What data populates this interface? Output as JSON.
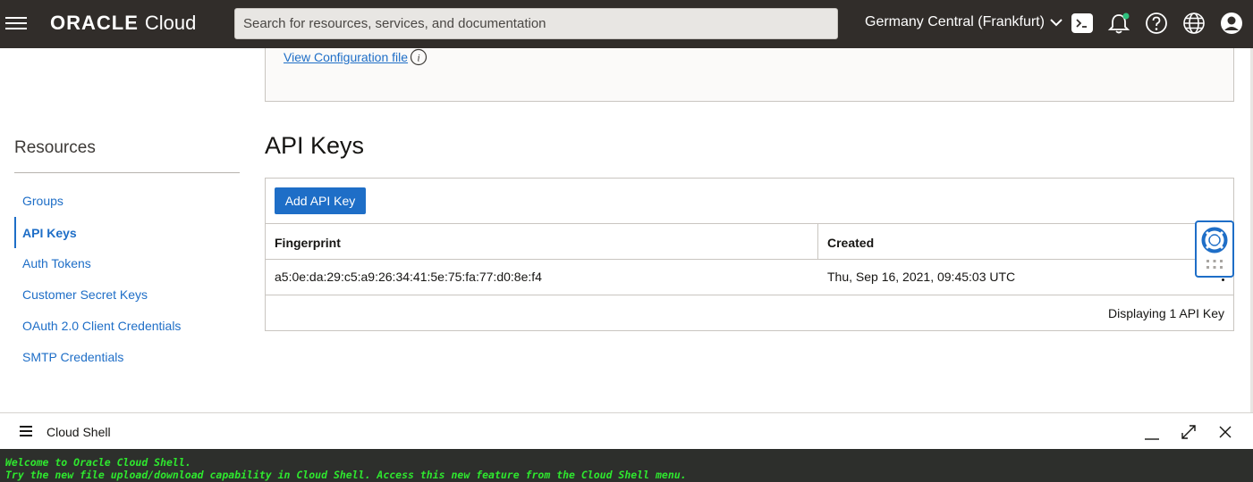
{
  "header": {
    "logo_primary": "ORACLE",
    "logo_secondary": "Cloud",
    "search_placeholder": "Search for resources, services, and documentation",
    "region": "Germany Central (Frankfurt)"
  },
  "config": {
    "link_label": "View Configuration file"
  },
  "resources": {
    "title": "Resources",
    "items": [
      {
        "label": "Groups",
        "active": false
      },
      {
        "label": "API Keys",
        "active": true
      },
      {
        "label": "Auth Tokens",
        "active": false
      },
      {
        "label": "Customer Secret Keys",
        "active": false
      },
      {
        "label": "OAuth 2.0 Client Credentials",
        "active": false
      },
      {
        "label": "SMTP Credentials",
        "active": false
      }
    ]
  },
  "api_keys": {
    "title": "API Keys",
    "add_button": "Add API Key",
    "columns": [
      "Fingerprint",
      "Created"
    ],
    "rows": [
      {
        "fingerprint": "a5:0e:da:29:c5:a9:26:34:41:5e:75:fa:77:d0:8e:f4",
        "created": "Thu, Sep 16, 2021, 09:45:03 UTC"
      }
    ],
    "footer": "Displaying 1 API Key"
  },
  "cloud_shell": {
    "title": "Cloud Shell",
    "lines": [
      "Welcome to Oracle Cloud Shell.",
      "Try the new file upload/download capability in Cloud Shell. Access this new feature from the Cloud Shell menu."
    ]
  },
  "colors": {
    "header_bg": "#312d2a",
    "link": "#1e6ec7",
    "terminal_bg": "#2d2f2c",
    "terminal_text": "#2ee82e",
    "notification_dot": "#2ec27e"
  }
}
